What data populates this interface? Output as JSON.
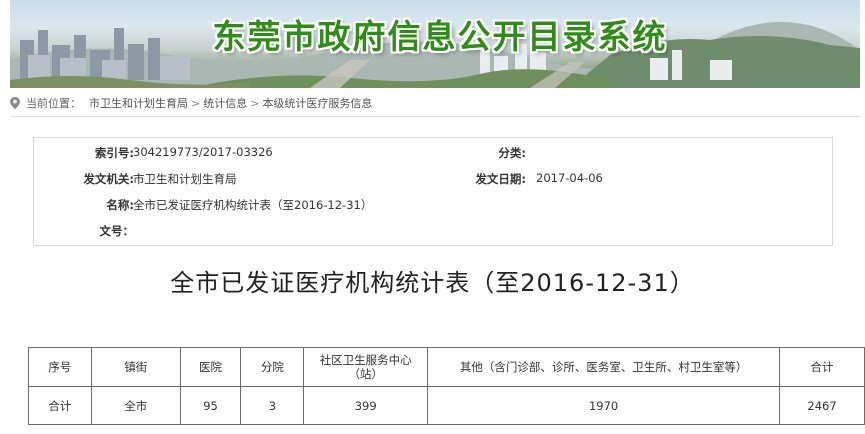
{
  "banner": {
    "title": "东莞市政府信息公开目录系统"
  },
  "breadcrumb": {
    "prefix": "当前位置：",
    "items": [
      "市卫生和计划生育局",
      "统计信息",
      "本级统计医疗服务信息"
    ],
    "separator": ">"
  },
  "info": {
    "index_label": "索引号:",
    "index_value": "304219773/2017-03326",
    "category_label": "分类:",
    "category_value": "",
    "issuer_label": "发文机关:",
    "issuer_value": "市卫生和计划生育局",
    "date_label": "发文日期:",
    "date_value": "2017-04-06",
    "name_label": "名称:",
    "name_value": "全市已发证医疗机构统计表（至2016-12-31）",
    "docno_label": "文号：",
    "docno_value": ""
  },
  "document": {
    "title": "全市已发证医疗机构统计表（至2016-12-31）"
  },
  "table": {
    "headers": [
      "序号",
      "镇街",
      "医院",
      "分院",
      "社区卫生服务中心（站）",
      "其他（含门诊部、诊所、医务室、卫生所、村卫生室等）",
      "合计"
    ],
    "rows": [
      [
        "合计",
        "全市",
        "95",
        "3",
        "399",
        "1970",
        "2467"
      ]
    ]
  }
}
